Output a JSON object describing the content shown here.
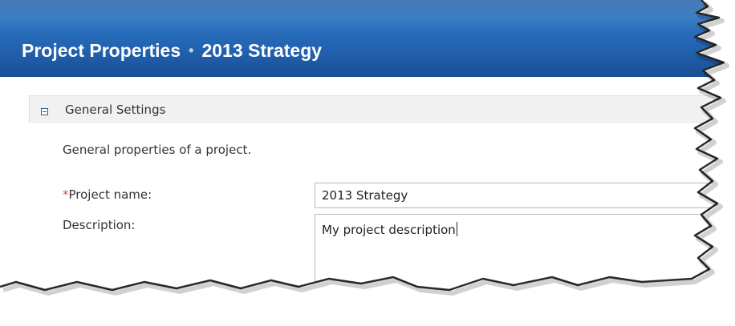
{
  "header": {
    "title": "Project Properties",
    "separator": "•",
    "project": "2013 Strategy"
  },
  "section": {
    "title": "General Settings",
    "description": "General properties of a project."
  },
  "form": {
    "required_marker": "*",
    "name_label": "Project name:",
    "name_value": "2013 Strategy",
    "description_label": "Description:",
    "description_value": "My project description"
  },
  "colors": {
    "header_blue": "#2364b2",
    "required_red": "#e04b2e"
  },
  "icons": {
    "collapse": "collapse-minus-icon"
  }
}
